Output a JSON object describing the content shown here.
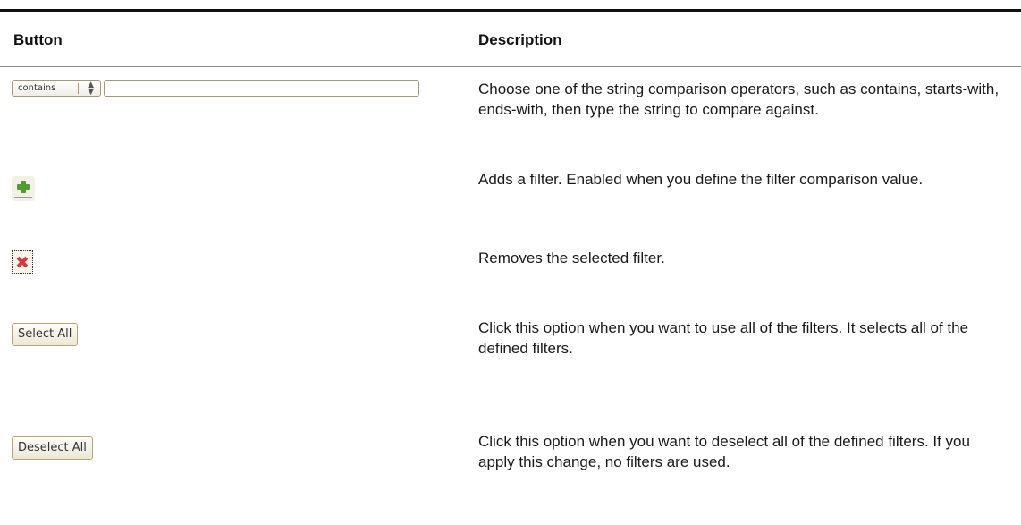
{
  "table": {
    "headers": {
      "button": "Button",
      "description": "Description"
    },
    "rows": [
      {
        "control": {
          "operator_value": "contains",
          "input_value": ""
        },
        "description": "Choose one of the string comparison operators, such as contains, starts-with, ends-with, then type the string to compare against."
      },
      {
        "control": {
          "icon": "add-filter-icon"
        },
        "description": "Adds a filter. Enabled when you define the filter comparison value."
      },
      {
        "control": {
          "icon": "remove-filter-icon"
        },
        "description": "Removes the selected filter."
      },
      {
        "control": {
          "label": "Select All"
        },
        "description": "Click this option when you want to use all of the filters. It selects all of the defined filters."
      },
      {
        "control": {
          "label": "Deselect All"
        },
        "description": "Click this option when you want to deselect all of the defined filters. If you apply this change, no filters are used."
      }
    ]
  }
}
